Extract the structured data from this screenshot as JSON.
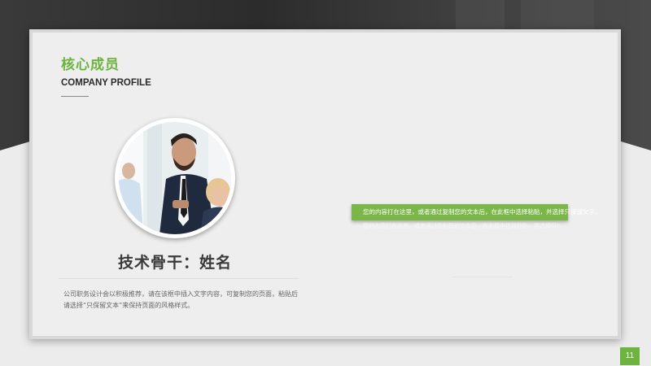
{
  "slide": {
    "title_cn": "核心成员",
    "title_en": "COMPANY PROFILE",
    "member_name": "技术骨干：姓名",
    "description": "公司职务设计会以积极推荐，请在该框中插入文字内容，可复制您的页面，粘贴后请选择“只保留文本”来保持页面的风格样式。",
    "highlight_text": "您的内容打在这里，或者通过复制您的文本后，在此框中选择粘贴，并选择只保留文字。",
    "subtext": "您的内容打在这里，或者通过复制您的文本后，在此框中选择粘贴，并选择只保留文字。",
    "page_number": "11"
  },
  "colors": {
    "accent": "#6db33f",
    "bar": "#7ab648",
    "background_dark": "#2f2f2f",
    "card": "#eeeeee"
  },
  "icons": {
    "photo": "team-member-photo"
  }
}
